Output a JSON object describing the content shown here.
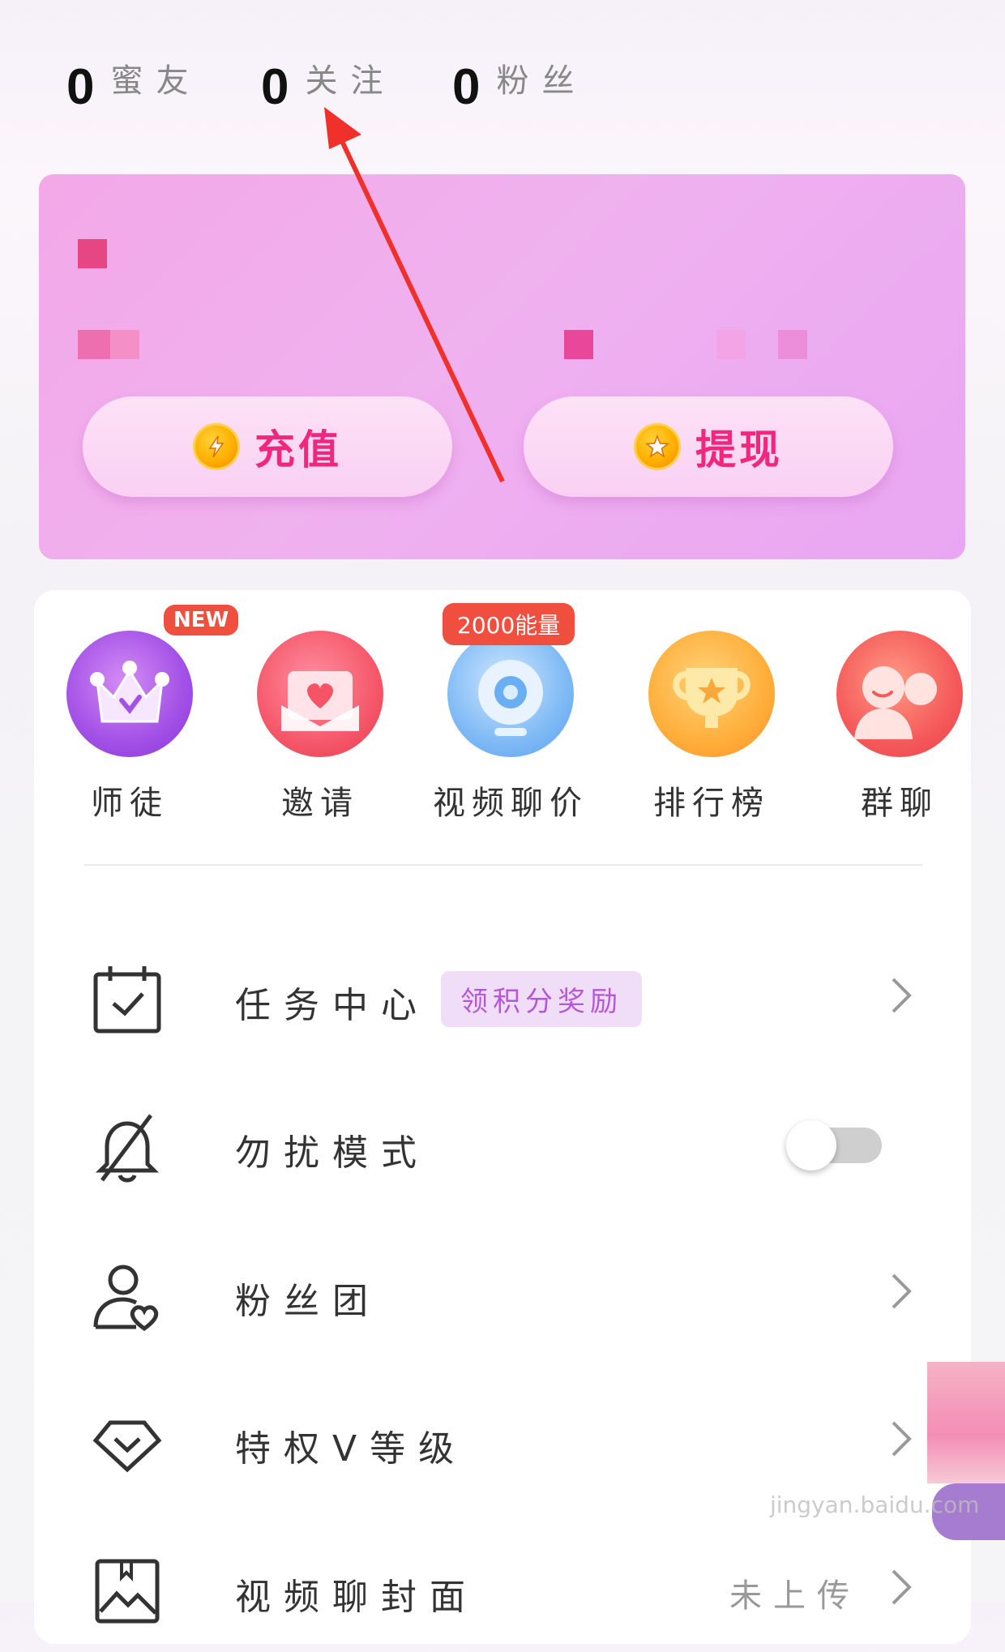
{
  "stats": [
    {
      "value": "0",
      "label": "蜜友"
    },
    {
      "value": "0",
      "label": "关注"
    },
    {
      "value": "0",
      "label": "粉丝"
    }
  ],
  "wallet": {
    "recharge_label": "充值",
    "withdraw_label": "提现"
  },
  "shortcuts": [
    {
      "label": "师徒",
      "badge": "NEW"
    },
    {
      "label": "邀请"
    },
    {
      "label": "视频聊价",
      "badge": "2000能量"
    },
    {
      "label": "排行榜"
    },
    {
      "label": "群聊"
    }
  ],
  "menu": {
    "task_center": {
      "label": "任务中心",
      "tag": "领积分奖励"
    },
    "dnd": {
      "label": "勿扰模式",
      "enabled": false
    },
    "fan_club": {
      "label": "粉丝团"
    },
    "privilege": {
      "label": "特权V等级"
    },
    "video_cover": {
      "label": "视频聊封面",
      "value": "未上传"
    }
  },
  "watermark": "jingyan.baidu.com",
  "colors": {
    "accent": "#f1267d",
    "card": "#f0b1ef",
    "arrow": "#f0302a"
  }
}
